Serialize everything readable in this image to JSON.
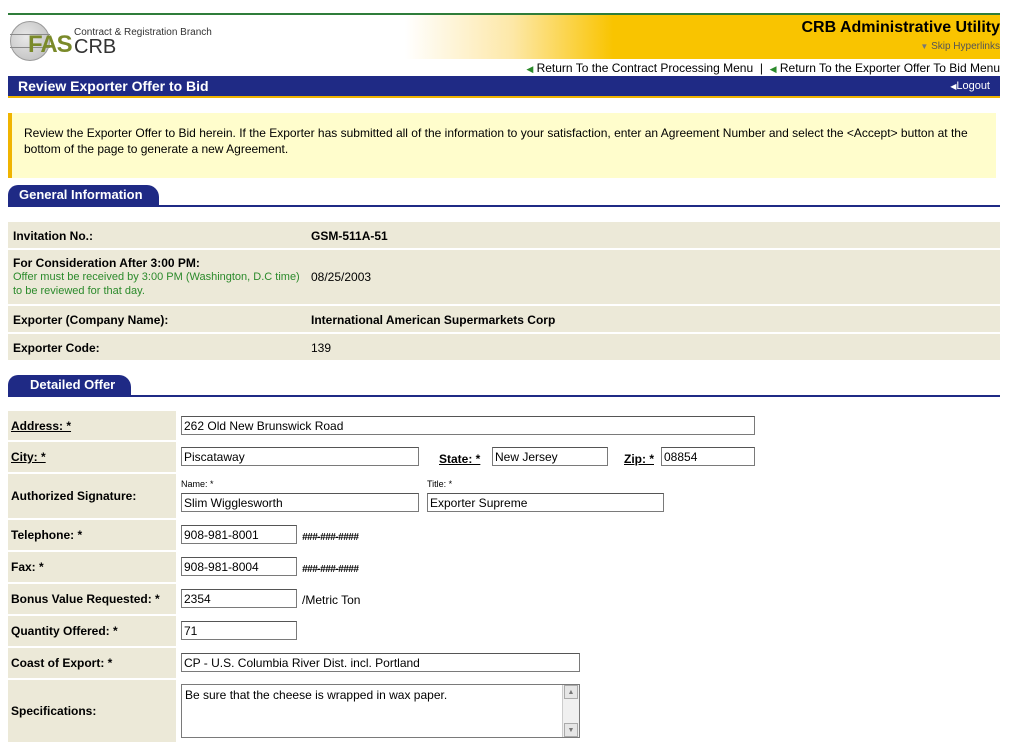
{
  "header": {
    "logo_fas": "FAS",
    "logo_crb": "CRB",
    "branch": "Contract & Registration Branch",
    "app_title": "CRB Administrative Utility",
    "skip_link": "Skip Hyperlinks",
    "link_contract_menu": "Return To the Contract Processing Menu",
    "separator": "|",
    "link_offer_menu": "Return To the Exporter Offer To Bid Menu"
  },
  "titlebar": {
    "title": "Review Exporter Offer to Bid",
    "logout": "Logout"
  },
  "notice": "Review the Exporter Offer to Bid herein.  If the Exporter has submitted all of the information to your satisfaction, enter an Agreement Number and select the <Accept> button at the bottom of the page to generate a new Agreement.",
  "general": {
    "heading": "General Information",
    "invitation_label": "Invitation No.:",
    "invitation_value": "GSM-511A-51",
    "consideration_label": "For Consideration After 3:00 PM:",
    "consideration_note": "Offer must be received by 3:00 PM (Washington, D.C time) to be reviewed for that day.",
    "consideration_value": "08/25/2003",
    "exporter_label": "Exporter (Company Name):",
    "exporter_value": "International American Supermarkets Corp",
    "code_label": "Exporter Code:",
    "code_value": "139"
  },
  "detailed": {
    "heading": "Detailed Offer",
    "address_label": "Address: *",
    "address_value": "262 Old New Brunswick Road",
    "city_label": "City: *",
    "city_value": "Piscataway",
    "state_label": "State: *",
    "state_value": "New Jersey",
    "zip_label": "Zip: *",
    "zip_value": "08854",
    "signature_label": "Authorized Signature:",
    "name_label": "Name: *",
    "name_value": "Slim Wigglesworth",
    "title_label": "Title: *",
    "title_value": "Exporter Supreme",
    "phone_label": "Telephone: *",
    "phone_value": "908-981-8001",
    "phone_format": "###-###-####",
    "fax_label": "Fax: *",
    "fax_value": "908-981-8004",
    "fax_format": "###-###-####",
    "bonus_label": "Bonus Value Requested: *",
    "bonus_value": "2354",
    "bonus_unit": "/Metric Ton",
    "quantity_label": "Quantity Offered: *",
    "quantity_value": "71",
    "coast_label": "Coast of Export: *",
    "coast_value": "CP - U.S. Columbia River Dist. incl. Portland",
    "spec_label": "Specifications:",
    "spec_value": "Be sure that the cheese is wrapped in wax paper."
  }
}
